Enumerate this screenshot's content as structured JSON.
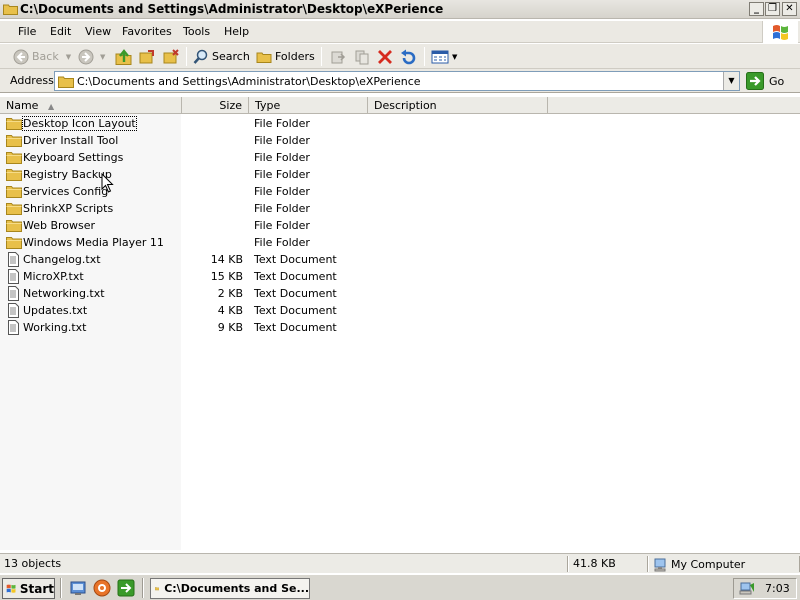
{
  "window": {
    "title": "C:\\Documents and Settings\\Administrator\\Desktop\\eXPerience",
    "minimize": "_",
    "restore": "❐",
    "close": "✕"
  },
  "menu": {
    "items": [
      {
        "label": "File"
      },
      {
        "label": "Edit"
      },
      {
        "label": "View"
      },
      {
        "label": "Favorites"
      },
      {
        "label": "Tools"
      },
      {
        "label": "Help"
      }
    ]
  },
  "toolbar": {
    "back_label": "Back",
    "search_label": "Search",
    "folders_label": "Folders"
  },
  "address": {
    "label": "Address",
    "value": "C:\\Documents and Settings\\Administrator\\Desktop\\eXPerience",
    "go_label": "Go"
  },
  "columns": {
    "name": "Name",
    "size": "Size",
    "type": "Type",
    "description": "Description"
  },
  "files": [
    {
      "name": "Desktop Icon Layout",
      "size": "",
      "type": "File Folder",
      "kind": "folder"
    },
    {
      "name": "Driver Install Tool",
      "size": "",
      "type": "File Folder",
      "kind": "folder"
    },
    {
      "name": "Keyboard Settings",
      "size": "",
      "type": "File Folder",
      "kind": "folder"
    },
    {
      "name": "Registry Backup",
      "size": "",
      "type": "File Folder",
      "kind": "folder"
    },
    {
      "name": "Services Config",
      "size": "",
      "type": "File Folder",
      "kind": "folder"
    },
    {
      "name": "ShrinkXP Scripts",
      "size": "",
      "type": "File Folder",
      "kind": "folder"
    },
    {
      "name": "Web Browser",
      "size": "",
      "type": "File Folder",
      "kind": "folder"
    },
    {
      "name": "Windows Media Player 11",
      "size": "",
      "type": "File Folder",
      "kind": "folder"
    },
    {
      "name": "Changelog.txt",
      "size": "14 KB",
      "type": "Text Document",
      "kind": "text"
    },
    {
      "name": "MicroXP.txt",
      "size": "15 KB",
      "type": "Text Document",
      "kind": "text"
    },
    {
      "name": "Networking.txt",
      "size": "2 KB",
      "type": "Text Document",
      "kind": "text"
    },
    {
      "name": "Updates.txt",
      "size": "4 KB",
      "type": "Text Document",
      "kind": "text"
    },
    {
      "name": "Working.txt",
      "size": "9 KB",
      "type": "Text Document",
      "kind": "text"
    }
  ],
  "status": {
    "objects": "13 objects",
    "size": "41.8 KB",
    "location": "My Computer"
  },
  "taskbar": {
    "start_label": "Start",
    "task_label": "C:\\Documents and Se...",
    "clock": "7:03"
  },
  "colors": {
    "folder": "#e8c04a",
    "folder_edge": "#a8861c",
    "accent_green": "#3a9a2a"
  }
}
